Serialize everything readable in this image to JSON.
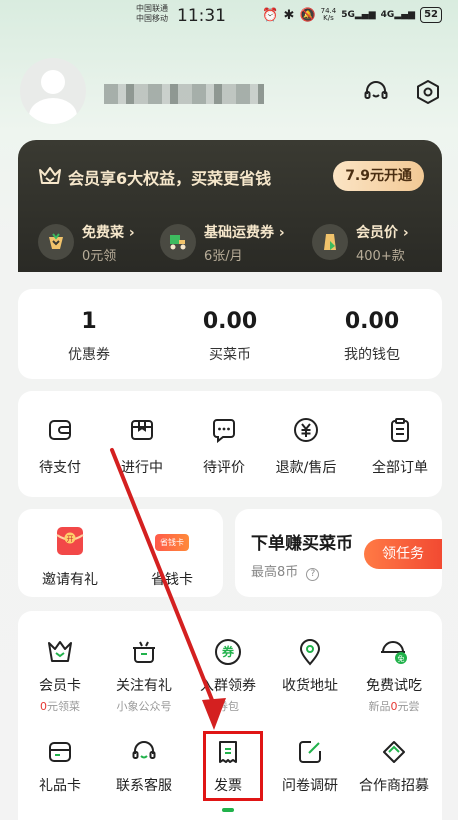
{
  "status_bar": {
    "carrier1": "中国联通",
    "carrier2": "中国移动",
    "time": "11:31",
    "speed_value": "74.4",
    "speed_unit": "K/s",
    "net1": "5G",
    "net2": "4G",
    "battery": "52"
  },
  "member": {
    "title": "会员享6大权益，买菜更省钱",
    "cta": "7.9元开通",
    "perks": [
      {
        "name": "免费菜",
        "sub": "0元领",
        "icon": "vegetable-icon"
      },
      {
        "name": "基础运费券",
        "sub": "6张/月",
        "icon": "delivery-scooter-icon"
      },
      {
        "name": "会员价",
        "sub": "400+款",
        "icon": "price-tag-icon"
      }
    ],
    "chevron": "›"
  },
  "stats": [
    {
      "value": "1",
      "label": "优惠券"
    },
    {
      "value": "0.00",
      "label": "买菜币"
    },
    {
      "value": "0.00",
      "label": "我的钱包"
    }
  ],
  "orders": [
    {
      "label": "待支付",
      "icon": "wallet-icon"
    },
    {
      "label": "进行中",
      "icon": "package-icon"
    },
    {
      "label": "待评价",
      "icon": "comment-icon"
    },
    {
      "label": "退款/售后",
      "icon": "refund-icon"
    },
    {
      "label": "全部订单",
      "icon": "order-list-icon"
    }
  ],
  "promos": [
    {
      "label": "邀请有礼",
      "badge": "开",
      "icon": "red-envelope-icon"
    },
    {
      "label": "省钱卡",
      "badge": "省钱卡",
      "icon": "savings-card-icon"
    }
  ],
  "task": {
    "title": "下单赚买菜币",
    "sub": "最高8币",
    "help": "?",
    "button": "领任务"
  },
  "services": [
    {
      "label": "会员卡",
      "sub_red": "0",
      "sub": "元领菜",
      "icon": "member-basket-icon"
    },
    {
      "label": "关注有礼",
      "sub_red": "",
      "sub": "小象公众号",
      "icon": "pot-icon"
    },
    {
      "label": "入群领券",
      "sub_red": "",
      "sub": "券包",
      "icon": "coupon-icon",
      "icon_text": "券"
    },
    {
      "label": "收货地址",
      "sub_red": "",
      "sub": "",
      "icon": "location-pin-icon"
    },
    {
      "label": "免费试吃",
      "sub_red": "0",
      "sub": "元尝",
      "sub_prefix": "新品",
      "icon": "free-tasting-icon",
      "icon_text": "免"
    },
    {
      "label": "礼品卡",
      "icon": "gift-card-icon"
    },
    {
      "label": "联系客服",
      "icon": "customer-service-icon"
    },
    {
      "label": "发票",
      "icon": "invoice-icon"
    },
    {
      "label": "问卷调研",
      "icon": "survey-edit-icon"
    },
    {
      "label": "合作商招募",
      "icon": "handshake-icon"
    }
  ],
  "colors": {
    "accent_green": "#21b24b",
    "annotation_red": "#e01515",
    "member_gold": "#f6e7cb"
  }
}
